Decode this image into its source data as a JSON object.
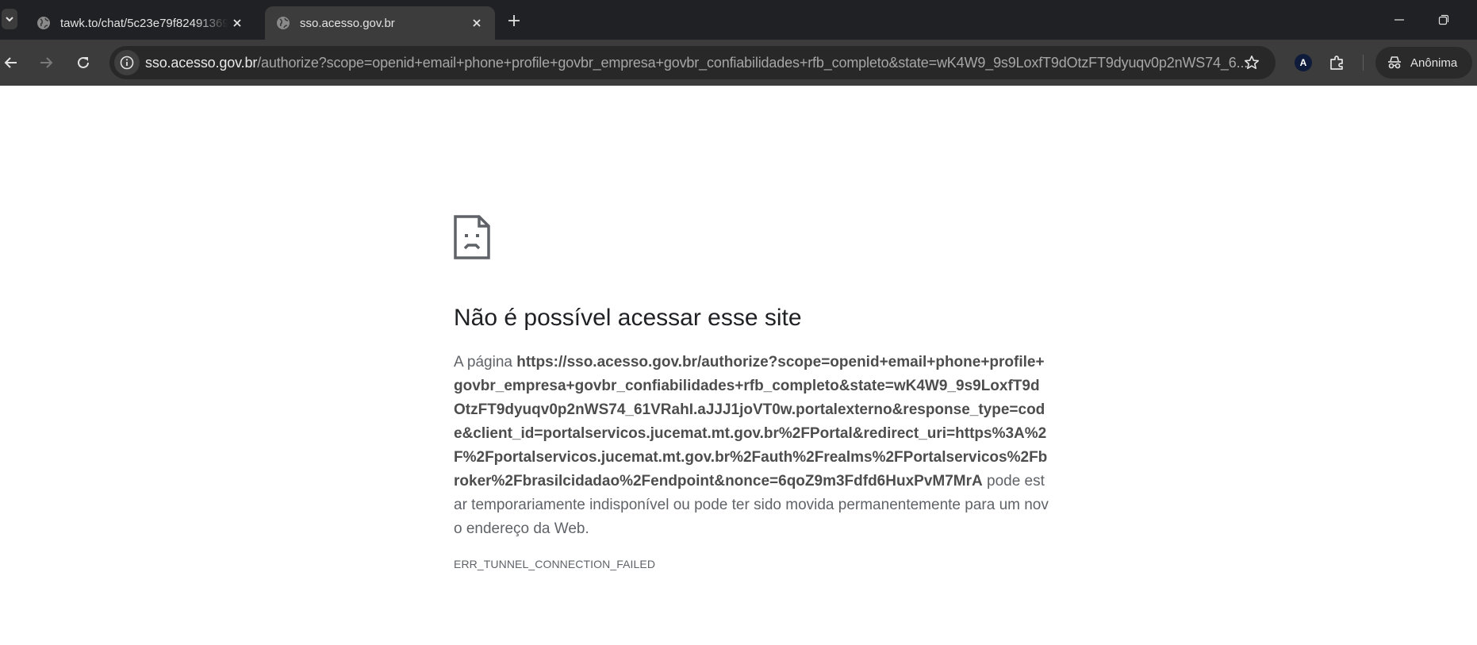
{
  "browser": {
    "tabs": [
      {
        "title": "tawk.to/chat/5c23e79f82491369",
        "active": false
      },
      {
        "title": "sso.acesso.gov.br",
        "active": true
      }
    ],
    "address_bar": {
      "host": "sso.acesso.gov.br",
      "path": "/authorize?scope=openid+email+phone+profile+govbr_empresa+govbr_confiabilidades+rfb_completo&state=wK4W9_9s9LoxfT9dOtzFT9dyuqv0p2nWS74_6..."
    },
    "profile": {
      "label": "Anônima"
    },
    "icons": {
      "tab_search": "chevron-down-icon",
      "favicon": "globe-icon",
      "close": "close-icon",
      "new_tab": "plus-icon",
      "back": "arrow-left-icon",
      "forward": "arrow-right-icon",
      "reload": "reload-icon",
      "site_info": "info-icon",
      "bookmark": "star-icon",
      "extension": "puzzle-icon",
      "incognito": "incognito-icon",
      "error": "sad-document-icon"
    },
    "extension_badge": "A"
  },
  "error_page": {
    "title": "Não é possível acessar esse site",
    "description_prefix": "A página",
    "url": "https://sso.acesso.gov.br/authorize?scope=openid+email+phone+profile+govbr_empresa+govbr_confiabilidades+rfb_completo&state=wK4W9_9s9LoxfT9dOtzFT9dyuqv0p2nWS74_61VRahI.aJJJ1joVT0w.portalexterno&response_type=code&client_id=portalservicos.jucemat.mt.gov.br%2FPortal&redirect_uri=https%3A%2F%2Fportalservicos.jucemat.mt.gov.br%2Fauth%2Frealms%2FPortalservicos%2Fbroker%2Fbrasilcidadao%2Fendpoint&nonce=6qoZ9m3Fdfd6HuxPvM7MrA",
    "description_suffix": "pode estar temporariamente indisponível ou pode ter sido movida permanentemente para um novo endereço da Web.",
    "error_code": "ERR_TUNNEL_CONNECTION_FAILED"
  },
  "colors": {
    "tabstrip_bg": "#202124",
    "toolbar_bg": "#3c3c3c",
    "omnibox_bg": "#282828",
    "title_text": "#202124",
    "body_text": "#5f6368"
  }
}
